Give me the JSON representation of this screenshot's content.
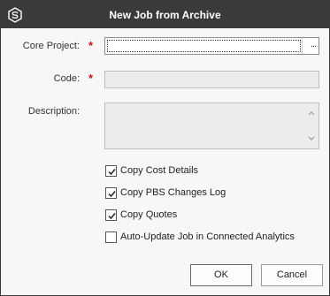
{
  "dialog": {
    "title": "New Job from Archive",
    "app_icon": "hex-logo-icon"
  },
  "form": {
    "core_project": {
      "label": "Core Project:",
      "required_mark": "*",
      "value": "",
      "browse_label": "..."
    },
    "code": {
      "label": "Code:",
      "required_mark": "*",
      "value": ""
    },
    "description": {
      "label": "Description:",
      "value": ""
    }
  },
  "options": [
    {
      "label": "Copy Cost Details",
      "checked": true
    },
    {
      "label": "Copy PBS Changes Log",
      "checked": true
    },
    {
      "label": "Copy Quotes",
      "checked": true
    },
    {
      "label": "Auto-Update Job in Connected Analytics",
      "checked": false
    }
  ],
  "buttons": {
    "ok": "OK",
    "cancel": "Cancel"
  },
  "colors": {
    "titlebar": "#3a3a3a",
    "required": "#d01010",
    "background": "#f7f7f7"
  }
}
